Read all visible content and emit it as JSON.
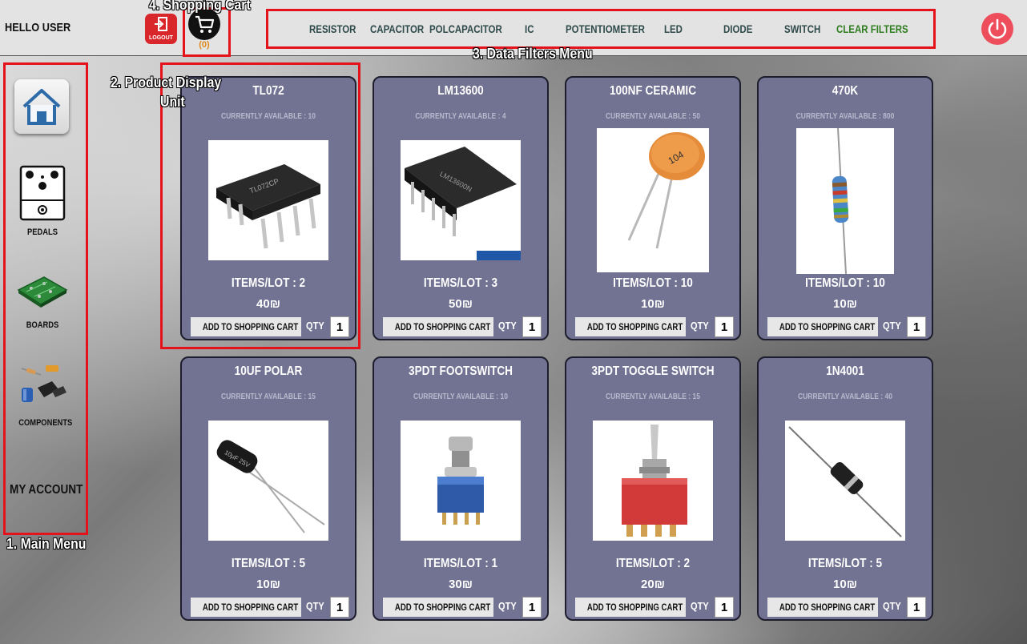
{
  "header": {
    "greeting": "HELLO USER",
    "logout_label": "LOGOUT",
    "cart_count": "(0)",
    "filters": [
      {
        "label": "RESISTOR"
      },
      {
        "label": "CAPACITOR"
      },
      {
        "label": "POLCAPACITOR"
      },
      {
        "label": "IC"
      },
      {
        "label": "POTENTIOMETER"
      },
      {
        "label": "LED"
      },
      {
        "label": "DIODE"
      },
      {
        "label": "SWITCH"
      },
      {
        "label": "CLEAR FILTERS"
      }
    ]
  },
  "sidebar": {
    "items": [
      {
        "label": "PEDALS"
      },
      {
        "label": "BOARDS"
      },
      {
        "label": "COMPONENTS"
      }
    ],
    "my_account": "MY ACCOUNT"
  },
  "annotations": {
    "main_menu": "1. Main Menu",
    "product_unit_line1": "2. Product Display",
    "product_unit_line2": "Unit",
    "filters_menu": "3. Data Filters Menu",
    "shopping_cart": "4. Shopping Cart"
  },
  "products": [
    {
      "name": "TL072",
      "available": "CURRENTLY AVAILABLE : 10",
      "lot": "ITEMS/LOT : 2",
      "price": "40₪",
      "add_label": "ADD TO SHOPPING CART",
      "qty_label": "QTY",
      "qty": "1"
    },
    {
      "name": "LM13600",
      "available": "CURRENTLY AVAILABLE : 4",
      "lot": "ITEMS/LOT : 3",
      "price": "50₪",
      "add_label": "ADD TO SHOPPING CART",
      "qty_label": "QTY",
      "qty": "1"
    },
    {
      "name": "100NF CERAMIC",
      "available": "CURRENTLY AVAILABLE : 50",
      "lot": "ITEMS/LOT : 10",
      "price": "10₪",
      "add_label": "ADD TO SHOPPING CART",
      "qty_label": "QTY",
      "qty": "1",
      "marking": "104"
    },
    {
      "name": "470K",
      "available": "CURRENTLY AVAILABLE : 800",
      "lot": "ITEMS/LOT : 10",
      "price": "10₪",
      "add_label": "ADD TO SHOPPING CART",
      "qty_label": "QTY",
      "qty": "1"
    },
    {
      "name": "10UF POLAR",
      "available": "CURRENTLY AVAILABLE : 15",
      "lot": "ITEMS/LOT : 5",
      "price": "10₪",
      "add_label": "ADD TO SHOPPING CART",
      "qty_label": "QTY",
      "qty": "1"
    },
    {
      "name": "3PDT FOOTSWITCH",
      "available": "CURRENTLY AVAILABLE : 10",
      "lot": "ITEMS/LOT : 1",
      "price": "30₪",
      "add_label": "ADD TO SHOPPING CART",
      "qty_label": "QTY",
      "qty": "1"
    },
    {
      "name": "3PDT TOGGLE SWITCH",
      "available": "CURRENTLY AVAILABLE : 15",
      "lot": "ITEMS/LOT : 2",
      "price": "20₪",
      "add_label": "ADD TO SHOPPING CART",
      "qty_label": "QTY",
      "qty": "1"
    },
    {
      "name": "1N4001",
      "available": "CURRENTLY AVAILABLE : 40",
      "lot": "ITEMS/LOT : 5",
      "price": "10₪",
      "add_label": "ADD TO SHOPPING CART",
      "qty_label": "QTY",
      "qty": "1"
    }
  ],
  "colors": {
    "card_bg": "#727293",
    "annotation_red": "#e5121b",
    "logout_red": "#d9262b",
    "power_red": "#ee4d5b",
    "clear_filters_green": "#2e7d1e",
    "cart_count_orange": "#e08a1e"
  },
  "icons": {
    "logout": "logout-icon",
    "cart": "shopping-cart-icon",
    "power": "power-icon",
    "home": "home-icon",
    "pedals": "pedal-icon",
    "boards": "circuit-board-icon",
    "components": "components-icon"
  }
}
